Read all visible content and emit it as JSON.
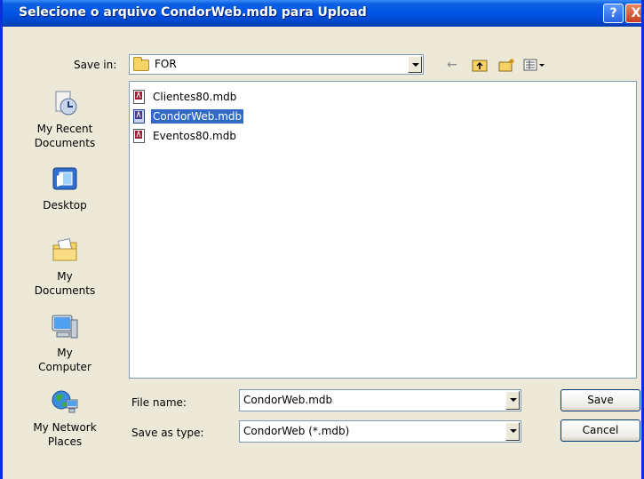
{
  "dialog": {
    "title": "Selecione o arquivo CondorWeb.mdb para Upload",
    "title_help": "?",
    "title_close": "X"
  },
  "save_in": {
    "label": "Save in:",
    "value": "FOR"
  },
  "toolbar": {
    "back_icon": "back-arrow-icon",
    "up_icon": "up-folder-icon",
    "new_folder_icon": "new-folder-icon",
    "view_icon": "view-menu-icon"
  },
  "places": [
    {
      "label": "My Recent Documents",
      "icon": "recent-documents-icon"
    },
    {
      "label": "Desktop",
      "icon": "desktop-icon"
    },
    {
      "label": "My Documents",
      "icon": "my-documents-icon"
    },
    {
      "label": "My Computer",
      "icon": "my-computer-icon"
    },
    {
      "label": "My Network Places",
      "icon": "network-places-icon"
    }
  ],
  "files": [
    {
      "name": "Clientes80.mdb",
      "selected": false
    },
    {
      "name": "CondorWeb.mdb",
      "selected": true
    },
    {
      "name": "Eventos80.mdb",
      "selected": false
    }
  ],
  "file_name": {
    "label": "File name:",
    "value": "CondorWeb.mdb"
  },
  "save_as_type": {
    "label": "Save as type:",
    "value": "CondorWeb (*.mdb)"
  },
  "buttons": {
    "save": "Save",
    "cancel": "Cancel"
  },
  "colors": {
    "selection": "#316AC5",
    "titlebar": "#0054E3",
    "dialog_bg": "#ECE9D8"
  }
}
